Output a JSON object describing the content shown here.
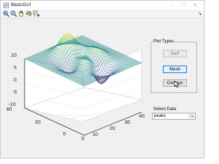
{
  "window": {
    "title": "BasicGUI",
    "minimize": "–",
    "maximize": "☐",
    "close": "✕"
  },
  "toolbar": {
    "tools": [
      "zoom-in-icon",
      "zoom-out-icon",
      "pan-icon",
      "rotate-3d-icon",
      "data-cursor-icon"
    ],
    "corner": "↘"
  },
  "plot": {
    "z_ticks": [
      "10",
      "5",
      "0",
      "-5",
      "-10"
    ],
    "y_ticks": [
      "40",
      "20",
      "0"
    ],
    "x_ticks": [
      "0",
      "10",
      "20",
      "30",
      "40"
    ],
    "colormap": [
      "#440154",
      "#3b528b",
      "#21918c",
      "#5ec962",
      "#fde725"
    ]
  },
  "panel": {
    "title": "Plot Types",
    "surf_label": "Surf",
    "mesh_label": "Mesh",
    "contour_label": "Contour"
  },
  "data_select": {
    "label": "Select Data",
    "value": "peaks"
  }
}
